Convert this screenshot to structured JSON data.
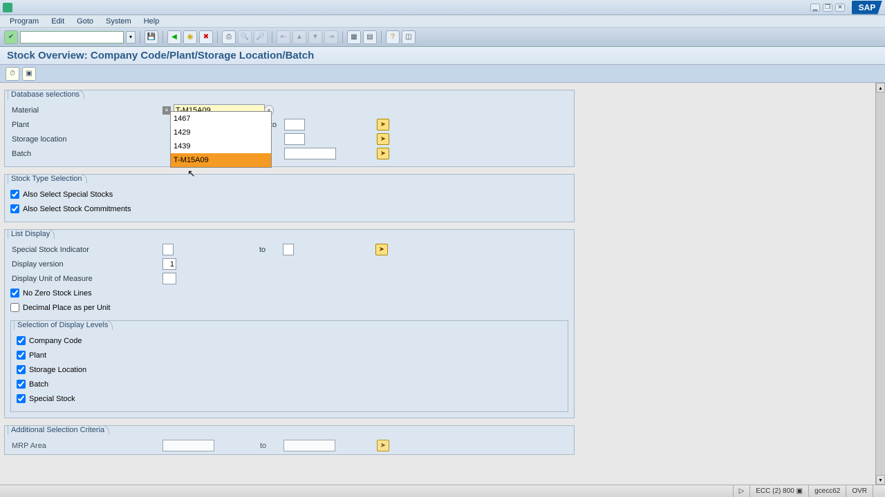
{
  "menu": {
    "program": "Program",
    "edit": "Edit",
    "goto": "Goto",
    "system": "System",
    "help": "Help"
  },
  "page_title": "Stock Overview: Company Code/Plant/Storage Location/Batch",
  "groups": {
    "db": {
      "title": "Database selections",
      "material_label": "Material",
      "material_value": "T-M15A09",
      "plant_label": "Plant",
      "storage_label": "Storage location",
      "batch_label": "Batch",
      "to": "to",
      "dropdown": [
        "1467",
        "1429",
        "1439",
        "T-M15A09"
      ]
    },
    "stype": {
      "title": "Stock Type Selection",
      "special": "Also Select Special Stocks",
      "commit": "Also Select Stock Commitments"
    },
    "list": {
      "title": "List Display",
      "ssi": "Special Stock Indicator",
      "to": "to",
      "dispver": "Display version",
      "dispver_val": "1",
      "uom": "Display Unit of Measure",
      "nozero": "No Zero Stock Lines",
      "decimal": "Decimal Place as per Unit",
      "levels_title": "Selection of Display Levels",
      "levels": [
        "Company Code",
        "Plant",
        "Storage Location",
        "Batch",
        "Special Stock"
      ]
    },
    "addl": {
      "title": "Additional Selection Criteria",
      "mrp": "MRP Area",
      "to": "to"
    }
  },
  "status": {
    "client": "ECC (2) 800",
    "host": "gcecc62",
    "mode": "OVR"
  }
}
